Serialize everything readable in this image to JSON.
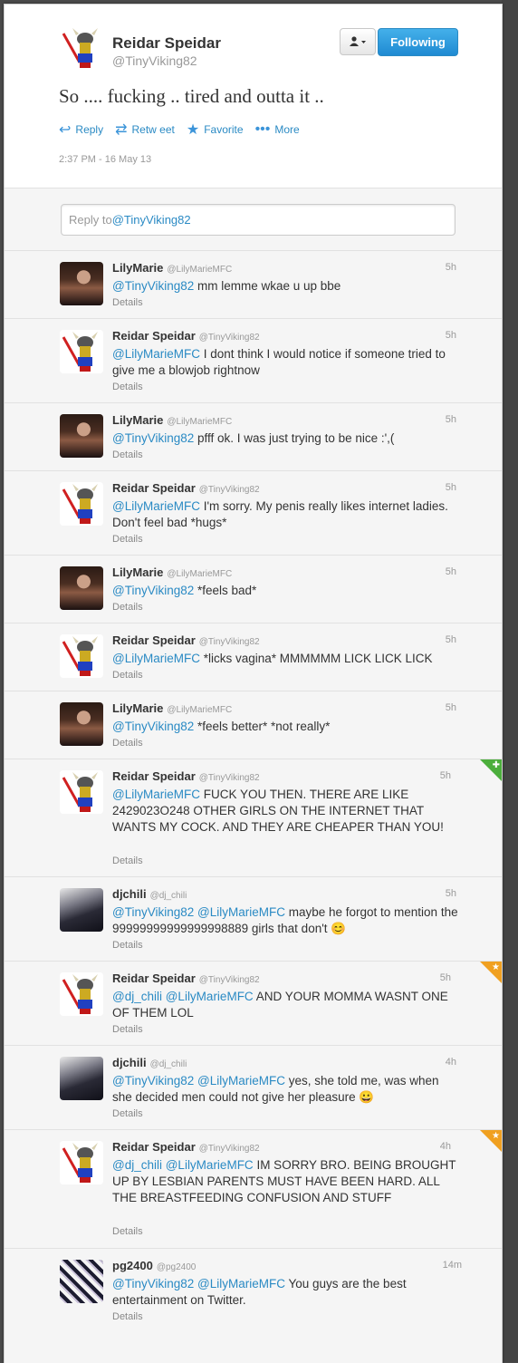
{
  "main_tweet": {
    "name": "Reidar Speidar",
    "handle": "@TinyViking82",
    "text": "So .... fucking .. tired and outta it ..",
    "follow_button": "Following",
    "actions": {
      "reply": "Reply",
      "retweet": "Retw eet",
      "favorite": "Favorite",
      "more": "More"
    },
    "timestamp": "2:37 PM - 16 May 13"
  },
  "reply_box": {
    "prefix": "Reply to ",
    "mention": "@TinyViking82"
  },
  "replies": [
    {
      "name": "LilyMarie",
      "handle": "@LilyMarieMFC",
      "time": "5h",
      "mention": "@TinyViking82",
      "text": " mm lemme wkae u up bbe",
      "details": "Details"
    },
    {
      "name": "Reidar Speidar",
      "handle": "@TinyViking82",
      "time": "5h",
      "mention": "@LilyMarieMFC",
      "text": " I dont think I would notice if someone tried to give me a blowjob rightnow",
      "details": "Details"
    },
    {
      "name": "LilyMarie",
      "handle": "@LilyMarieMFC",
      "time": "5h",
      "mention": "@TinyViking82",
      "text": " pfff ok. I was just trying to be nice :',(",
      "details": "Details"
    },
    {
      "name": "Reidar Speidar",
      "handle": "@TinyViking82",
      "time": "5h",
      "mention": "@LilyMarieMFC",
      "text": " I'm sorry. My penis really likes internet ladies. Don't feel bad *hugs*",
      "details": "Details"
    },
    {
      "name": "LilyMarie",
      "handle": "@LilyMarieMFC",
      "time": "5h",
      "mention": "@TinyViking82",
      "text": " *feels bad*",
      "details": "Details"
    },
    {
      "name": "Reidar Speidar",
      "handle": "@TinyViking82",
      "time": "5h",
      "mention": "@LilyMarieMFC",
      "text": " *licks vagina* MMMMMM LICK LICK LICK",
      "details": "Details"
    },
    {
      "name": "LilyMarie",
      "handle": "@LilyMarieMFC",
      "time": "5h",
      "mention": "@TinyViking82",
      "text": " *feels better* *not really*",
      "details": "Details"
    },
    {
      "name": "Reidar Speidar",
      "handle": "@TinyViking82",
      "time": "5h",
      "mention": "@LilyMarieMFC",
      "text": " FUCK YOU THEN. THERE ARE LIKE 2429023O248 OTHER GIRLS ON THE INTERNET THAT WANTS MY COCK. AND THEY ARE CHEAPER THAN YOU!",
      "details": "Details"
    },
    {
      "name": "djchili",
      "handle": "@dj_chili",
      "time": "5h",
      "mention": "@TinyViking82 @LilyMarieMFC",
      "text": " maybe he forgot to mention the 99999999999999998889 girls that don't 😊",
      "details": "Details"
    },
    {
      "name": "Reidar Speidar",
      "handle": "@TinyViking82",
      "time": "5h",
      "mention": "@dj_chili @LilyMarieMFC",
      "text": " AND YOUR MOMMA WASNT ONE OF THEM LOL",
      "details": "Details"
    },
    {
      "name": "djchili",
      "handle": "@dj_chili",
      "time": "4h",
      "mention": "@TinyViking82 @LilyMarieMFC",
      "text": " yes, she told me, was when she decided men could not give her pleasure 😀",
      "details": "Details"
    },
    {
      "name": "Reidar Speidar",
      "handle": "@TinyViking82",
      "time": "4h",
      "mention": "@dj_chili @LilyMarieMFC",
      "text": " IM SORRY BRO. BEING BROUGHT UP BY LESBIAN PARENTS MUST HAVE BEEN HARD. ALL THE BREASTFEEDING CONFUSION AND STUFF",
      "details": "Details"
    },
    {
      "name": "pg2400",
      "handle": "@pg2400",
      "time": "14m",
      "mention": "@TinyViking82 @LilyMarieMFC",
      "text": " You guys are the best entertainment on Twitter.",
      "details": "Details"
    }
  ],
  "colors": {
    "link": "#2a8ac4",
    "follow_button": "#1f8ad2",
    "star_badge": "#f0a020",
    "green_badge": "#4cae3c"
  }
}
